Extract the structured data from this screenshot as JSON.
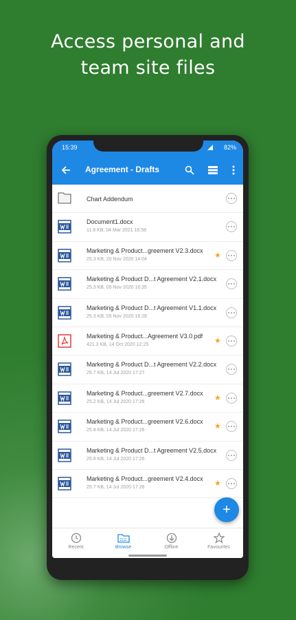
{
  "headline": {
    "line1": "Access personal and",
    "line2": "team site files"
  },
  "status": {
    "time": "15:39",
    "battery": "82%"
  },
  "appbar": {
    "title": "Agreement - Drafts",
    "back_icon": "arrow-left-icon",
    "search_icon": "search-icon",
    "view_icon": "grid-view-icon",
    "more_icon": "more-vertical-icon"
  },
  "files": [
    {
      "name": "Chart Addendum",
      "meta": "",
      "type": "folder",
      "favorite": false
    },
    {
      "name": "Document1.docx",
      "meta": "11.8 KB, 04 Mar 2021 16:58",
      "type": "word",
      "favorite": false
    },
    {
      "name": "Marketing & Product...greement V2.3.docx",
      "meta": "25.3 KB, 20 Nov 2020 14:04",
      "type": "word",
      "favorite": true
    },
    {
      "name": "Marketing & Product D...t Agreement V2.1.docx",
      "meta": "25.3 KB, 05 Nov 2020 16:35",
      "type": "word",
      "favorite": false
    },
    {
      "name": "Marketing & Product D...t Agreement V1.1.docx",
      "meta": "25.3 KB, 05 Nov 2020 16:28",
      "type": "word",
      "favorite": false
    },
    {
      "name": "Marketing & Product...Agreement V3.0.pdf",
      "meta": "421.3 KB, 14 Oct 2020 12:25",
      "type": "pdf",
      "favorite": true
    },
    {
      "name": "Marketing & Product D...t Agreement V2.2.docx",
      "meta": "25.7 KB, 14 Jul 2020 17:27",
      "type": "word",
      "favorite": false
    },
    {
      "name": "Marketing & Product...greement V2.7.docx",
      "meta": "25.2 KB, 14 Jul 2020 17:26",
      "type": "word",
      "favorite": true
    },
    {
      "name": "Marketing & Product...greement V2.6.docx",
      "meta": "25.8 KB, 14 Jul 2020 17:26",
      "type": "word",
      "favorite": true
    },
    {
      "name": "Marketing & Product D...t Agreement V2.5.docx",
      "meta": "25.8 KB, 14 Jul 2020 17:26",
      "type": "word",
      "favorite": false
    },
    {
      "name": "Marketing & Product...greement V2.4.docx",
      "meta": "25.7 KB, 14 Jul 2020 17:26",
      "type": "word",
      "favorite": true
    }
  ],
  "fab": {
    "icon": "plus-icon",
    "label": "+"
  },
  "nav": [
    {
      "label": "Recent",
      "icon": "clock-icon",
      "active": false
    },
    {
      "label": "Browse",
      "icon": "folder-icon",
      "active": true
    },
    {
      "label": "Offline",
      "icon": "download-icon",
      "active": false
    },
    {
      "label": "Favourites",
      "icon": "star-icon",
      "active": false
    }
  ],
  "colors": {
    "background": "#2f7d2f",
    "accent": "#1e88e5",
    "star": "#f5a623",
    "word": "#2b579a",
    "pdf": "#e53935"
  }
}
